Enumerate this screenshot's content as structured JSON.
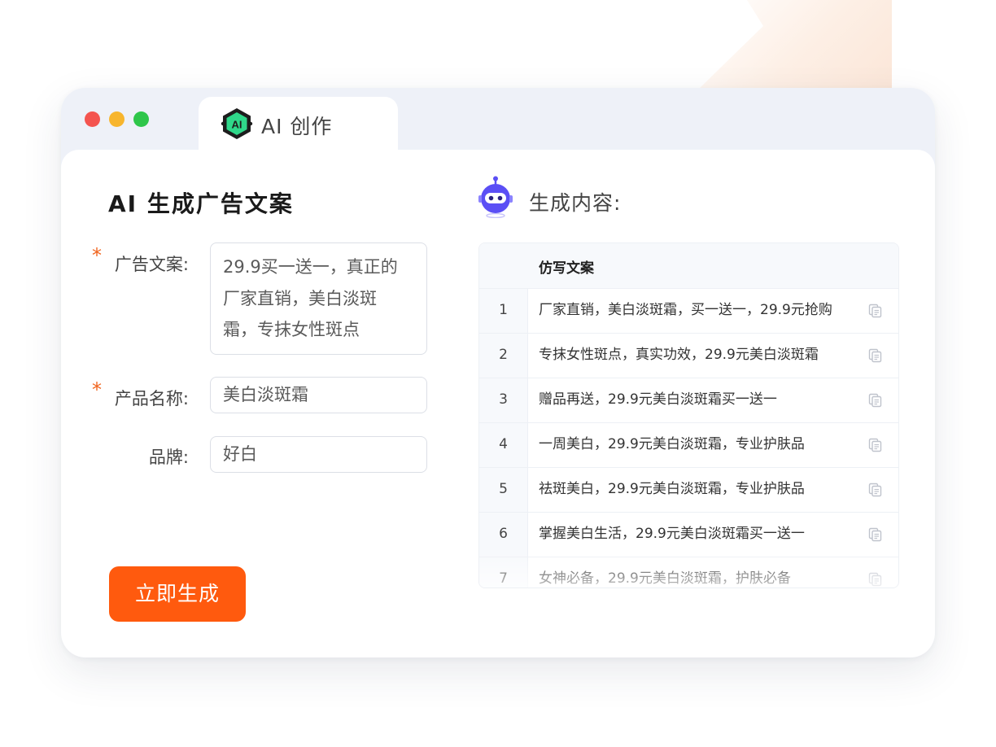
{
  "window": {
    "tab_title": "AI 创作",
    "tab_icon": "ai-logo-icon"
  },
  "form": {
    "title": "AI 生成广告文案",
    "required_mark": "*",
    "ad_copy_label": "广告文案:",
    "ad_copy_lines": [
      "29.9买一送一，真正的",
      "厂家直销，美白淡斑",
      "霜，专抹女性斑点"
    ],
    "product_label": "产品名称:",
    "product_value": "美白淡斑霜",
    "brand_label": "品牌:",
    "brand_value": "好白",
    "submit_label": "立即生成"
  },
  "results": {
    "title": "生成内容:",
    "column_header": "仿写文案",
    "rows": [
      {
        "index": "1",
        "text": "厂家直销，美白淡斑霜，买一送一，29.9元抢购"
      },
      {
        "index": "2",
        "text": "专抹女性斑点，真实功效，29.9元美白淡斑霜"
      },
      {
        "index": "3",
        "text": "赠品再送，29.9元美白淡斑霜买一送一"
      },
      {
        "index": "4",
        "text": "一周美白，29.9元美白淡斑霜，专业护肤品"
      },
      {
        "index": "5",
        "text": "祛斑美白，29.9元美白淡斑霜，专业护肤品"
      },
      {
        "index": "6",
        "text": "掌握美白生活，29.9元美白淡斑霜买一送一"
      },
      {
        "index": "7",
        "text": "女神必备，29.9元美白淡斑霜，护肤必备"
      }
    ]
  },
  "colors": {
    "accent": "#ff5a0e",
    "required": "#f0641e",
    "dot_red": "#f4544f",
    "dot_yellow": "#f7b52d",
    "dot_green": "#2ec64a",
    "robot": "#5b4ff5"
  }
}
